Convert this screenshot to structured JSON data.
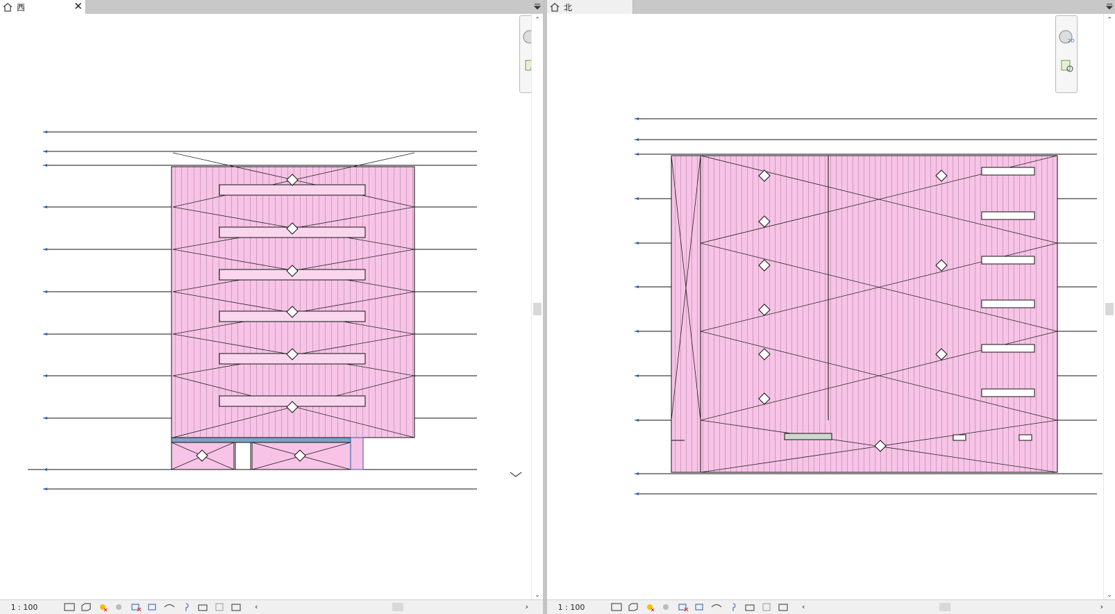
{
  "left_view": {
    "tab_title": "西",
    "scale": "1 : 100"
  },
  "right_view": {
    "tab_title": "北",
    "scale": "1 : 100"
  },
  "colors": {
    "facade_fill": "#f7c3e6",
    "line": "#111111",
    "tab_strip": "#c8c8c8"
  },
  "icons": [
    "home-icon",
    "close-icon",
    "tab-menu-icon",
    "2d-wheel-icon",
    "zoom-region-icon",
    "model-graphics-icon",
    "visual-style-icon",
    "sun-path-icon",
    "shadows-icon",
    "crop-view-icon",
    "show-crop-icon",
    "temporary-hide-icon",
    "reveal-hidden-icon",
    "lock-3d-icon",
    "highlight-icon",
    "analytic-icon"
  ]
}
